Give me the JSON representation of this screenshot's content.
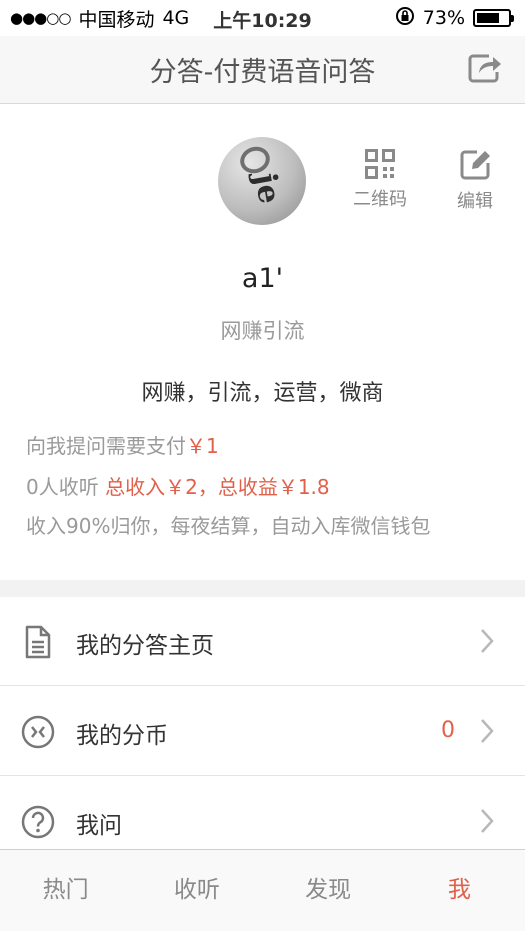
{
  "status_bar": {
    "signal": "●●●○○",
    "carrier": "中国移动",
    "network": "4G",
    "time": "上午10:29",
    "battery_percent": "73%",
    "battery_level": 0.73
  },
  "header": {
    "title": "分答-付费语音问答",
    "share_icon": "share-icon"
  },
  "profile": {
    "qr_label": "二维码",
    "edit_label": "编辑",
    "username": "a1'",
    "subtitle": "网赚引流",
    "bio": "网赚，引流，运营，微商",
    "ask_price_label": "向我提问需要支付",
    "ask_price_value": "￥1",
    "listeners": "0人收听",
    "income_text": "总收入￥2，总收益￥1.8",
    "note": "收入90%归你，每夜结算，自动入库微信钱包"
  },
  "menu": {
    "items": [
      {
        "label": "我的分答主页",
        "icon": "document-icon",
        "count": ""
      },
      {
        "label": "我的分币",
        "icon": "coin-icon",
        "count": "0"
      },
      {
        "label": "我问",
        "icon": "question-icon",
        "count": ""
      }
    ]
  },
  "tabbar": {
    "tabs": [
      {
        "label": "热门"
      },
      {
        "label": "收听"
      },
      {
        "label": "发现"
      },
      {
        "label": "我"
      }
    ]
  },
  "colors": {
    "accent": "#e0614a",
    "muted": "#9a9a9a"
  }
}
